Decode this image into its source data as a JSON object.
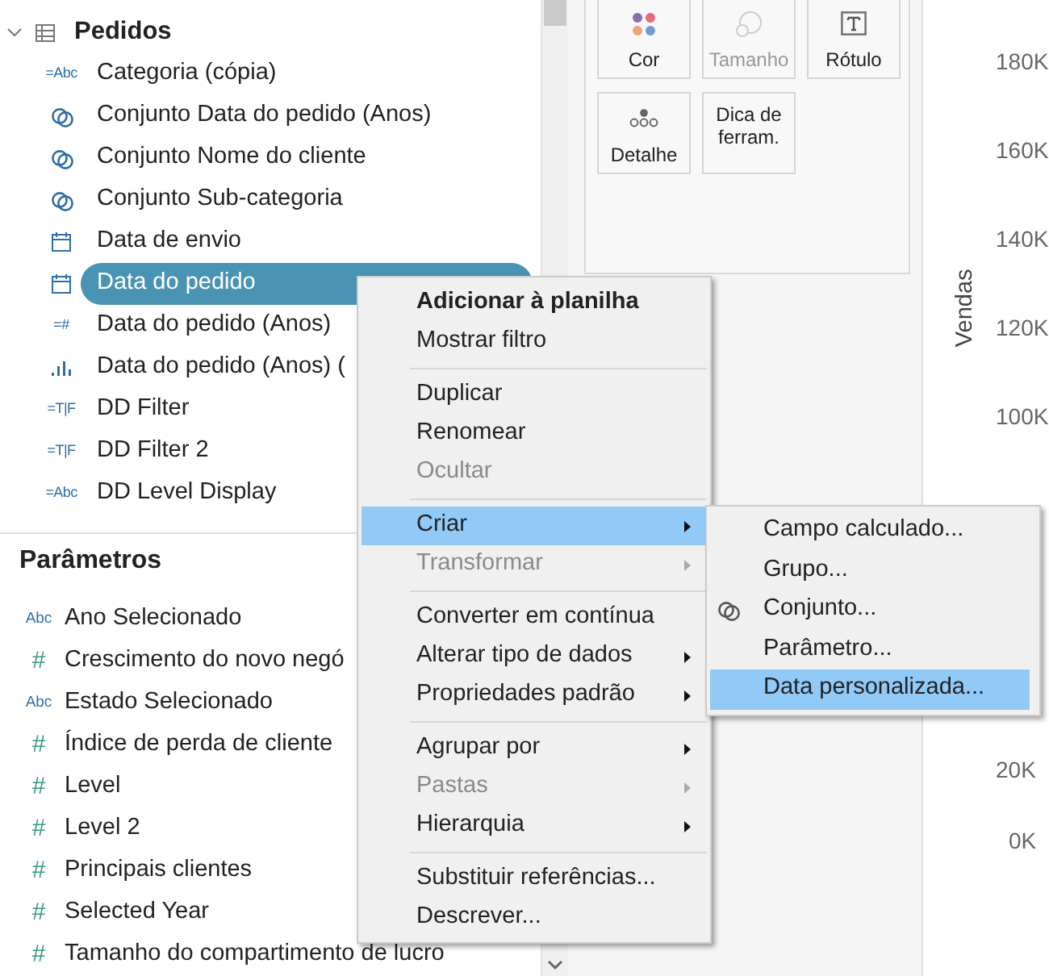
{
  "data_pane": {
    "header": {
      "label": "Pedidos",
      "expanded": true
    },
    "fields": [
      {
        "kind": "glyph",
        "glyph": "=Abc",
        "label": "Categoria (cópia)",
        "selected": false
      },
      {
        "kind": "set",
        "label": "Conjunto Data do pedido (Anos)",
        "selected": false
      },
      {
        "kind": "set",
        "label": "Conjunto Nome do cliente",
        "selected": false
      },
      {
        "kind": "set",
        "label": "Conjunto Sub-categoria",
        "selected": false
      },
      {
        "kind": "date",
        "label": "Data de envio",
        "selected": false
      },
      {
        "kind": "date",
        "label": "Data do pedido",
        "selected": true
      },
      {
        "kind": "glyph",
        "glyph": "=#",
        "label": "Data do pedido (Anos)",
        "selected": false
      },
      {
        "kind": "bin",
        "label": "Data do pedido (Anos) (",
        "selected": false
      },
      {
        "kind": "glyph",
        "glyph": "=T|F",
        "label": "DD Filter",
        "selected": false
      },
      {
        "kind": "glyph",
        "glyph": "=T|F",
        "label": "DD Filter 2",
        "selected": false
      },
      {
        "kind": "glyph",
        "glyph": "=Abc",
        "label": "DD Level Display",
        "selected": false
      }
    ]
  },
  "parameters": {
    "title": "Parâmetros",
    "items": [
      {
        "glyph": "Abc",
        "label": "Ano Selecionado"
      },
      {
        "glyph": "#",
        "label": "Crescimento do novo negó"
      },
      {
        "glyph": "Abc",
        "label": "Estado Selecionado"
      },
      {
        "glyph": "#",
        "label": "Índice de perda de cliente"
      },
      {
        "glyph": "#",
        "label": "Level"
      },
      {
        "glyph": "#",
        "label": "Level 2"
      },
      {
        "glyph": "#",
        "label": "Principais clientes"
      },
      {
        "glyph": "#",
        "label": "Selected Year"
      },
      {
        "glyph": "#",
        "label": "Tamanho do compartimento de lucro"
      }
    ]
  },
  "marks_card": {
    "buttons": [
      {
        "kind": "color",
        "label": "Cor",
        "disabled": false
      },
      {
        "kind": "size",
        "label": "Tamanho",
        "disabled": true
      },
      {
        "kind": "label",
        "label": "Rótulo",
        "disabled": false
      },
      {
        "kind": "detail",
        "label": "Detalhe",
        "disabled": false
      },
      {
        "kind": "tooltip",
        "label": "Dica de ferram.",
        "disabled": false
      }
    ]
  },
  "axis": {
    "title": "Vendas",
    "upper_ticks": [
      "180K",
      "160K",
      "140K",
      "120K",
      "100K"
    ],
    "lower_ticks": [
      "20K",
      "0K"
    ]
  },
  "context_menu": {
    "items": [
      {
        "kind": "item",
        "label": "Adicionar à planilha",
        "default": true,
        "disabled": false,
        "submenu": false,
        "selected": false
      },
      {
        "kind": "item",
        "label": "Mostrar filtro",
        "default": false,
        "disabled": false,
        "submenu": false,
        "selected": false
      },
      {
        "kind": "separator"
      },
      {
        "kind": "item",
        "label": "Duplicar",
        "default": false,
        "disabled": false,
        "submenu": false,
        "selected": false
      },
      {
        "kind": "item",
        "label": "Renomear",
        "default": false,
        "disabled": false,
        "submenu": false,
        "selected": false
      },
      {
        "kind": "item",
        "label": "Ocultar",
        "default": false,
        "disabled": true,
        "submenu": false,
        "selected": false
      },
      {
        "kind": "separator"
      },
      {
        "kind": "item",
        "label": "Criar",
        "default": false,
        "disabled": false,
        "submenu": true,
        "selected": true
      },
      {
        "kind": "item",
        "label": "Transformar",
        "default": false,
        "disabled": true,
        "submenu": true,
        "selected": false
      },
      {
        "kind": "separator"
      },
      {
        "kind": "item",
        "label": "Converter em contínua",
        "default": false,
        "disabled": false,
        "submenu": false,
        "selected": false
      },
      {
        "kind": "item",
        "label": "Alterar tipo de dados",
        "default": false,
        "disabled": false,
        "submenu": true,
        "selected": false
      },
      {
        "kind": "item",
        "label": "Propriedades padrão",
        "default": false,
        "disabled": false,
        "submenu": true,
        "selected": false
      },
      {
        "kind": "separator"
      },
      {
        "kind": "item",
        "label": "Agrupar por",
        "default": false,
        "disabled": false,
        "submenu": true,
        "selected": false
      },
      {
        "kind": "item",
        "label": "Pastas",
        "default": false,
        "disabled": true,
        "submenu": true,
        "selected": false
      },
      {
        "kind": "item",
        "label": "Hierarquia",
        "default": false,
        "disabled": false,
        "submenu": true,
        "selected": false
      },
      {
        "kind": "separator"
      },
      {
        "kind": "item",
        "label": "Substituir referências...",
        "default": false,
        "disabled": false,
        "submenu": false,
        "selected": false
      },
      {
        "kind": "item",
        "label": "Descrever...",
        "default": false,
        "disabled": false,
        "submenu": false,
        "selected": false
      }
    ]
  },
  "submenu": {
    "items": [
      {
        "kind": "plain",
        "label": "Campo calculado...",
        "selected": false
      },
      {
        "kind": "plain",
        "label": "Grupo...",
        "selected": false
      },
      {
        "kind": "set",
        "label": "Conjunto...",
        "selected": false
      },
      {
        "kind": "plain",
        "label": "Parâmetro...",
        "selected": false
      },
      {
        "kind": "plain",
        "label": "Data personalizada...",
        "selected": true
      }
    ]
  }
}
